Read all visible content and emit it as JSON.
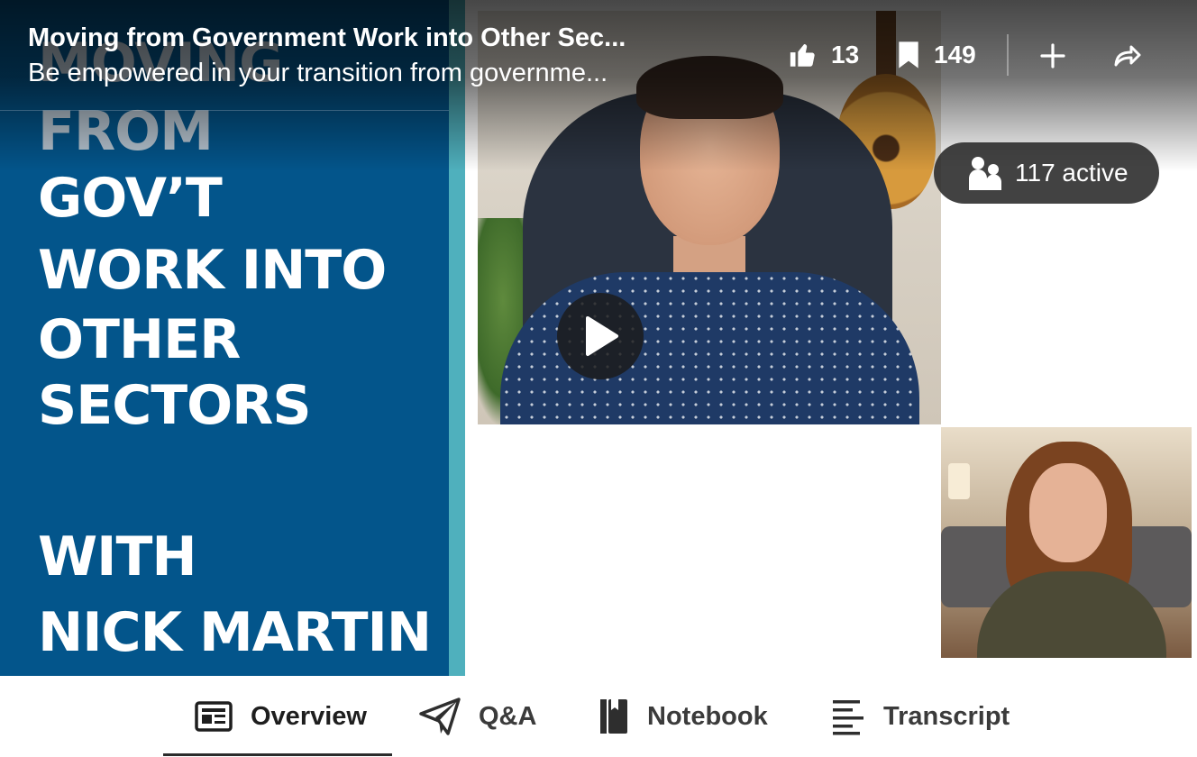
{
  "header": {
    "title": "Moving from Government Work into Other Sec...",
    "subtitle": "Be empowered in your transition from governme...",
    "likes_count": "13",
    "saves_count": "149"
  },
  "icons": {
    "like": "thumbs-up-icon",
    "save": "bookmark-icon",
    "add": "plus-icon",
    "share": "share-arrow-icon",
    "active": "people-icon",
    "play": "play-icon"
  },
  "slide": {
    "lines": [
      "MOVING",
      "FROM",
      "GOV’T",
      "WORK INTO",
      "OTHER",
      "SECTORS",
      "WITH",
      "NICK MARTIN"
    ]
  },
  "viewers": {
    "active_label": "117 active"
  },
  "tabs": [
    {
      "label": "Overview",
      "icon": "overview-icon",
      "active": true
    },
    {
      "label": "Q&A",
      "icon": "paper-plane-icon",
      "active": false
    },
    {
      "label": "Notebook",
      "icon": "notebook-icon",
      "active": false
    },
    {
      "label": "Transcript",
      "icon": "transcript-icon",
      "active": false
    }
  ],
  "colors": {
    "slide_background": "#03558b",
    "slide_accent": "#4fb0bd",
    "overlay": "#000000",
    "tab_text": "#1e1e1e"
  }
}
